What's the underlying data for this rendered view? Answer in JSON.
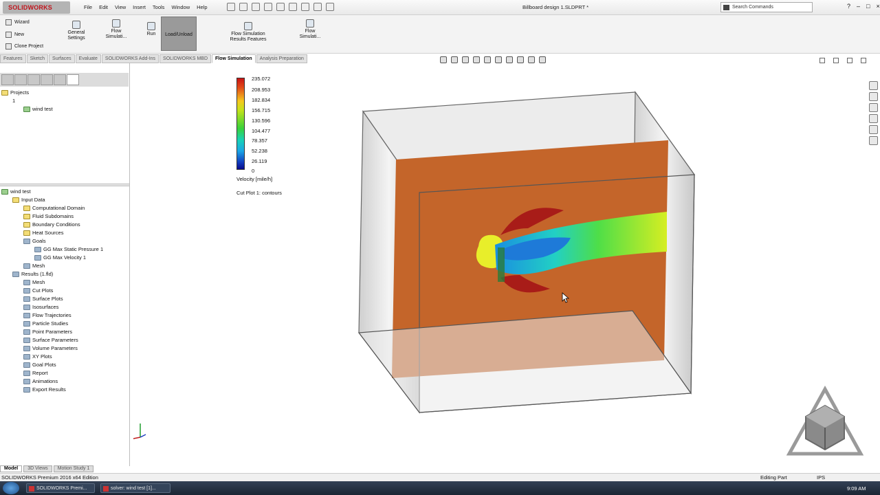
{
  "app": {
    "brand": "SOLIDWORKS",
    "menu": [
      "File",
      "Edit",
      "View",
      "Insert",
      "Tools",
      "Window",
      "Help"
    ],
    "document_title": "Billboard design 1.SLDPRT *",
    "search_placeholder": "Search Commands",
    "window_buttons": [
      "?",
      "–",
      "□",
      "×"
    ]
  },
  "ribbon": {
    "wizard": "Wizard",
    "new": "New",
    "clone_project": "Clone Project",
    "general_settings": "General Settings",
    "flow_simulation_1": "Flow Simulati...",
    "run": "Run",
    "load_unload": "Load/Unload",
    "flow_sim_results_features": "Flow Simulation Results Features",
    "flow_simulation_2": "Flow Simulati..."
  },
  "tabs": {
    "items": [
      "Features",
      "Sketch",
      "Surfaces",
      "Evaluate",
      "SOLIDWORKS Add-Ins",
      "SOLIDWORKS MBD",
      "Flow Simulation",
      "Analysis Preparation"
    ],
    "active_index": 6
  },
  "projects_tree": {
    "root": "Projects",
    "config": "1",
    "child": "wind test"
  },
  "analysis_tree": {
    "root": "wind test",
    "input_data": "Input Data",
    "input_items": [
      "Computational Domain",
      "Fluid Subdomains",
      "Boundary Conditions",
      "Heat Sources"
    ],
    "goals": "Goals",
    "goal_items": [
      "GG Max Static Pressure 1",
      "GG Max Velocity 1"
    ],
    "mesh": "Mesh",
    "results": "Results (1.fld)",
    "results_items": [
      "Mesh",
      "Cut Plots",
      "Surface Plots",
      "Isosurfaces",
      "Flow Trajectories",
      "Particle Studies",
      "Point Parameters",
      "Surface Parameters",
      "Volume Parameters",
      "XY Plots",
      "Goal Plots",
      "Report",
      "Animations",
      "Export Results"
    ]
  },
  "legend": {
    "values": [
      "235.072",
      "208.953",
      "182.834",
      "156.715",
      "130.596",
      "104.477",
      "78.357",
      "52.238",
      "26.119",
      "0"
    ],
    "unit_label": "Velocity [mile/h]",
    "plot_label": "Cut Plot 1: contours",
    "colors": [
      "#c81414",
      "#f5c81e",
      "#3ad23a",
      "#1aa6e6",
      "#0a0a8c"
    ]
  },
  "bottom_tabs": [
    "Model",
    "3D Views",
    "Motion Study 1"
  ],
  "status": {
    "left": "SOLIDWORKS Premium 2016 x64 Edition",
    "editing": "Editing Part",
    "units": "IPS"
  },
  "taskbar": {
    "items": [
      "SOLIDWORKS Premi...",
      "solver: wind test [1]..."
    ],
    "time": "9:09 AM"
  },
  "colors": {
    "domain_face": "#c4652a",
    "ribbon_bg": "#f3f3f3",
    "active_tab": "#ffffff"
  }
}
